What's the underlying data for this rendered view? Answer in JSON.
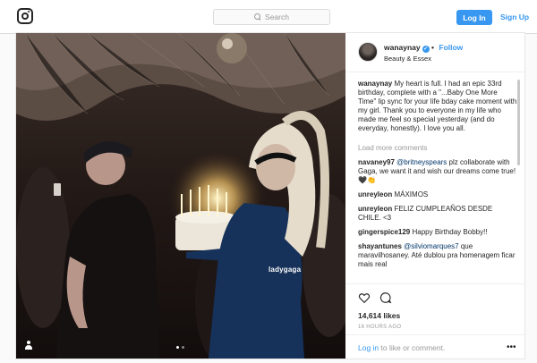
{
  "nav": {
    "search_placeholder": "Search",
    "login_label": "Log In",
    "signup_label": "Sign Up"
  },
  "photo": {
    "tag": "ladygaga",
    "carousel": {
      "count": 2,
      "active": 1
    }
  },
  "post": {
    "username": "wanaynay",
    "verified_badge": "✓",
    "follow_label": "Follow",
    "follow_separator": "•",
    "location": "Beauty & Essex",
    "caption_user": "wanaynay",
    "caption_text": "My heart is full. I had an epic 33rd birthday, complete with a \"...Baby One More Time\" lip sync for your life bday cake moment with my girl. Thank you to everyone in my life who made me feel so special yesterday (and do everyday, honestly). I love you all.",
    "load_more": "Load more comments",
    "comments": [
      {
        "user": "navaney97",
        "mention": "@britneyspears",
        "text": "plz collaborate with Gaga, we want it and wish our dreams come true!🖤👏"
      },
      {
        "user": "unreyleon",
        "mention": "",
        "text": "MÁXIMOS"
      },
      {
        "user": "unreyleon",
        "mention": "",
        "text": "FELIZ CUMPLEAÑOS DESDE CHILE. <3"
      },
      {
        "user": "gingerspice129",
        "mention": "",
        "text": "Happy Birthday Bobby!!"
      },
      {
        "user": "shayantunes",
        "mention": "@silviomarques7",
        "text": "que maravilhosaney. Até dublou pra homenagem ficar mais real"
      }
    ],
    "likes": "14,614 likes",
    "time": "16 HOURS AGO",
    "login_link": "Log in",
    "comment_prompt": "to like or comment.",
    "options": "•••"
  },
  "colors": {
    "accent": "#3897f0",
    "border": "#dbdbdb",
    "muted": "#999999"
  }
}
